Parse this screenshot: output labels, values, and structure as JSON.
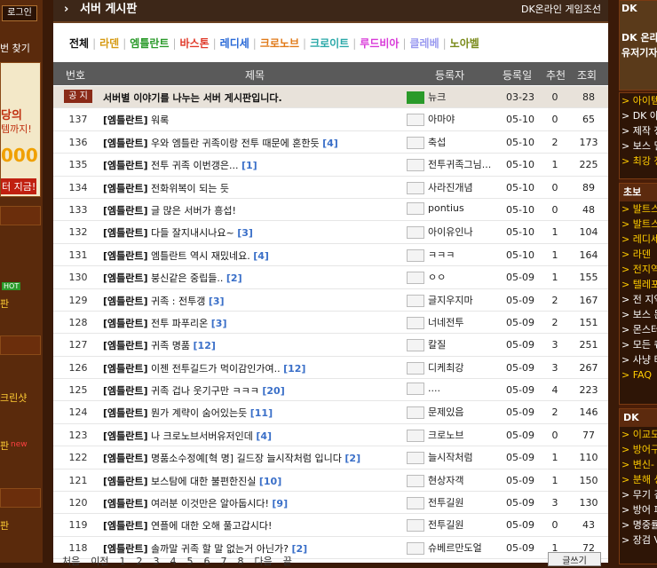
{
  "left": {
    "login": "로그인",
    "find": "번 찾기",
    "texts": [
      "당의",
      "템까지!",
      "000",
      "터 지금!",
      "HOT",
      "판",
      "크린샷",
      "판",
      "new",
      "판"
    ]
  },
  "main": {
    "board_title": "서버 게시판",
    "site_name": "DK온라인 게임조선",
    "tabs": [
      {
        "label": "전체",
        "color": "#111111"
      },
      {
        "label": "라덴",
        "color": "#d69a12"
      },
      {
        "label": "엠틀란트",
        "color": "#2a9a2a"
      },
      {
        "label": "바스톤",
        "color": "#e03a2a"
      },
      {
        "label": "레디세",
        "color": "#2a6ad8"
      },
      {
        "label": "크로노브",
        "color": "#e07a1a"
      },
      {
        "label": "크로이트",
        "color": "#2aa8a8"
      },
      {
        "label": "루드비아",
        "color": "#d83ad8"
      },
      {
        "label": "클레베",
        "color": "#9a9af0"
      },
      {
        "label": "노아벨",
        "color": "#7a8a1a"
      }
    ],
    "columns": {
      "no": "번호",
      "subject": "제목",
      "author": "등록자",
      "date": "등록일",
      "rec": "추천",
      "views": "조회"
    },
    "notice": {
      "badge": "공 지",
      "subject": "서버별 이야기를 나누는 서버 게시판입니다.",
      "author": "뉴크",
      "date": "03-23",
      "rec": "0",
      "views": "88"
    },
    "posts": [
      {
        "no": "137",
        "tag": "[엠틀란트]",
        "subject": "워록",
        "count": "",
        "author": "아마야",
        "date": "05-10",
        "rec": "0",
        "views": "65"
      },
      {
        "no": "136",
        "tag": "[엠틀란트]",
        "subject": "우와 엠틀란 귀족이랑 전투 때문에 혼한듯",
        "count": "[4]",
        "author": "축섭",
        "date": "05-10",
        "rec": "2",
        "views": "173"
      },
      {
        "no": "135",
        "tag": "[엠틀란트]",
        "subject": "전투 귀족 이번갱은...",
        "count": "[1]",
        "author": "전투귀족그님...",
        "date": "05-10",
        "rec": "1",
        "views": "225"
      },
      {
        "no": "134",
        "tag": "[엠틀란트]",
        "subject": "전화위복이 되는 듯",
        "count": "",
        "author": "사라진개념",
        "date": "05-10",
        "rec": "0",
        "views": "89"
      },
      {
        "no": "133",
        "tag": "[엠틀란트]",
        "subject": "글 많은 서버가 흥섭!",
        "count": "",
        "author": "pontius",
        "date": "05-10",
        "rec": "0",
        "views": "48"
      },
      {
        "no": "132",
        "tag": "[엠틀란트]",
        "subject": "다들 잘지내시나요~",
        "count": "[3]",
        "author": "아이유인나",
        "date": "05-10",
        "rec": "1",
        "views": "104"
      },
      {
        "no": "131",
        "tag": "[엠틀란트]",
        "subject": "엠틀란트 역시 재밌네요.",
        "count": "[4]",
        "author": "ㅋㅋㅋ",
        "date": "05-10",
        "rec": "1",
        "views": "164"
      },
      {
        "no": "130",
        "tag": "[엠틀란트]",
        "subject": "붕신같은 중립들..",
        "count": "[2]",
        "author": "ㅇㅇ",
        "date": "05-09",
        "rec": "1",
        "views": "155"
      },
      {
        "no": "129",
        "tag": "[엠틀란트]",
        "subject": "귀족 : 전투갱",
        "count": "[3]",
        "author": "글지우지마",
        "date": "05-09",
        "rec": "2",
        "views": "167"
      },
      {
        "no": "128",
        "tag": "[엠틀란트]",
        "subject": "전투 파푸리온",
        "count": "[3]",
        "author": "너네전투",
        "date": "05-09",
        "rec": "2",
        "views": "151"
      },
      {
        "no": "127",
        "tag": "[엠틀란트]",
        "subject": "귀족 명품",
        "count": "[12]",
        "author": "칼질",
        "date": "05-09",
        "rec": "3",
        "views": "251"
      },
      {
        "no": "126",
        "tag": "[엠틀란트]",
        "subject": "이젠 전투길드가 먹이감인가여..",
        "count": "[12]",
        "author": "디케최강",
        "date": "05-09",
        "rec": "3",
        "views": "267"
      },
      {
        "no": "125",
        "tag": "[엠틀란트]",
        "subject": "귀족 겁나 웃기구만 ㅋㅋㅋ",
        "count": "[20]",
        "author": "....",
        "date": "05-09",
        "rec": "4",
        "views": "223"
      },
      {
        "no": "124",
        "tag": "[엠틀란트]",
        "subject": "뭔가 계략이 숨어있는듯",
        "count": "[11]",
        "author": "문제있음",
        "date": "05-09",
        "rec": "2",
        "views": "146"
      },
      {
        "no": "123",
        "tag": "[엠틀란트]",
        "subject": "나 크로노브서버유저인데",
        "count": "[4]",
        "author": "크로노브",
        "date": "05-09",
        "rec": "0",
        "views": "77"
      },
      {
        "no": "122",
        "tag": "[엠틀란트]",
        "subject": "명품소수정예[혁 명] 길드장 늘시작처럼 입니다",
        "count": "[2]",
        "author": "늘시작처럼",
        "date": "05-09",
        "rec": "1",
        "views": "110"
      },
      {
        "no": "121",
        "tag": "[엠틀란트]",
        "subject": "보스탐에 대한 불편한진실",
        "count": "[10]",
        "author": "현상자객",
        "date": "05-09",
        "rec": "1",
        "views": "150"
      },
      {
        "no": "120",
        "tag": "[엠틀란트]",
        "subject": "여러분 이것만은 알아둡시다!",
        "count": "[9]",
        "author": "전투길원",
        "date": "05-09",
        "rec": "3",
        "views": "130"
      },
      {
        "no": "119",
        "tag": "[엠틀란트]",
        "subject": "연플에 대한 오해 풀고갑시다!",
        "count": "",
        "author": "전투길원",
        "date": "05-09",
        "rec": "0",
        "views": "43"
      },
      {
        "no": "118",
        "tag": "[엠틀란트]",
        "subject": "솔까말 귀족 할 말 없는거 아닌가?",
        "count": "[2]",
        "author": "슈베르만도얼",
        "date": "05-09",
        "rec": "1",
        "views": "72"
      }
    ],
    "pager": {
      "first": "처음",
      "prev": "이전",
      "pages": [
        "1",
        "2",
        "3",
        "4",
        "5",
        "6",
        "7",
        "8"
      ],
      "next": "다음",
      "last": "끝",
      "list_button": "글쓰기"
    }
  },
  "right": {
    "top": "DK",
    "promo": [
      "DK 온라",
      "유저기자"
    ],
    "menu1": [
      "아이템",
      "DK 아",
      "제작 정",
      "보스 밀",
      "최강 정"
    ],
    "panel2_title": "초보",
    "menu2": [
      "발트스",
      "발트스",
      "레디세",
      "라덴",
      "전지역",
      "텔레포",
      "전 지역",
      "보스 몬",
      "몬스터",
      "모든 퀘",
      "사냥 터",
      "FAQ"
    ],
    "panel3_title": "DK",
    "menu3": [
      "이교도",
      "방어구",
      "변신-",
      "분해 성",
      "무기 검",
      "방어 피",
      "명중률",
      "장검 V"
    ]
  }
}
